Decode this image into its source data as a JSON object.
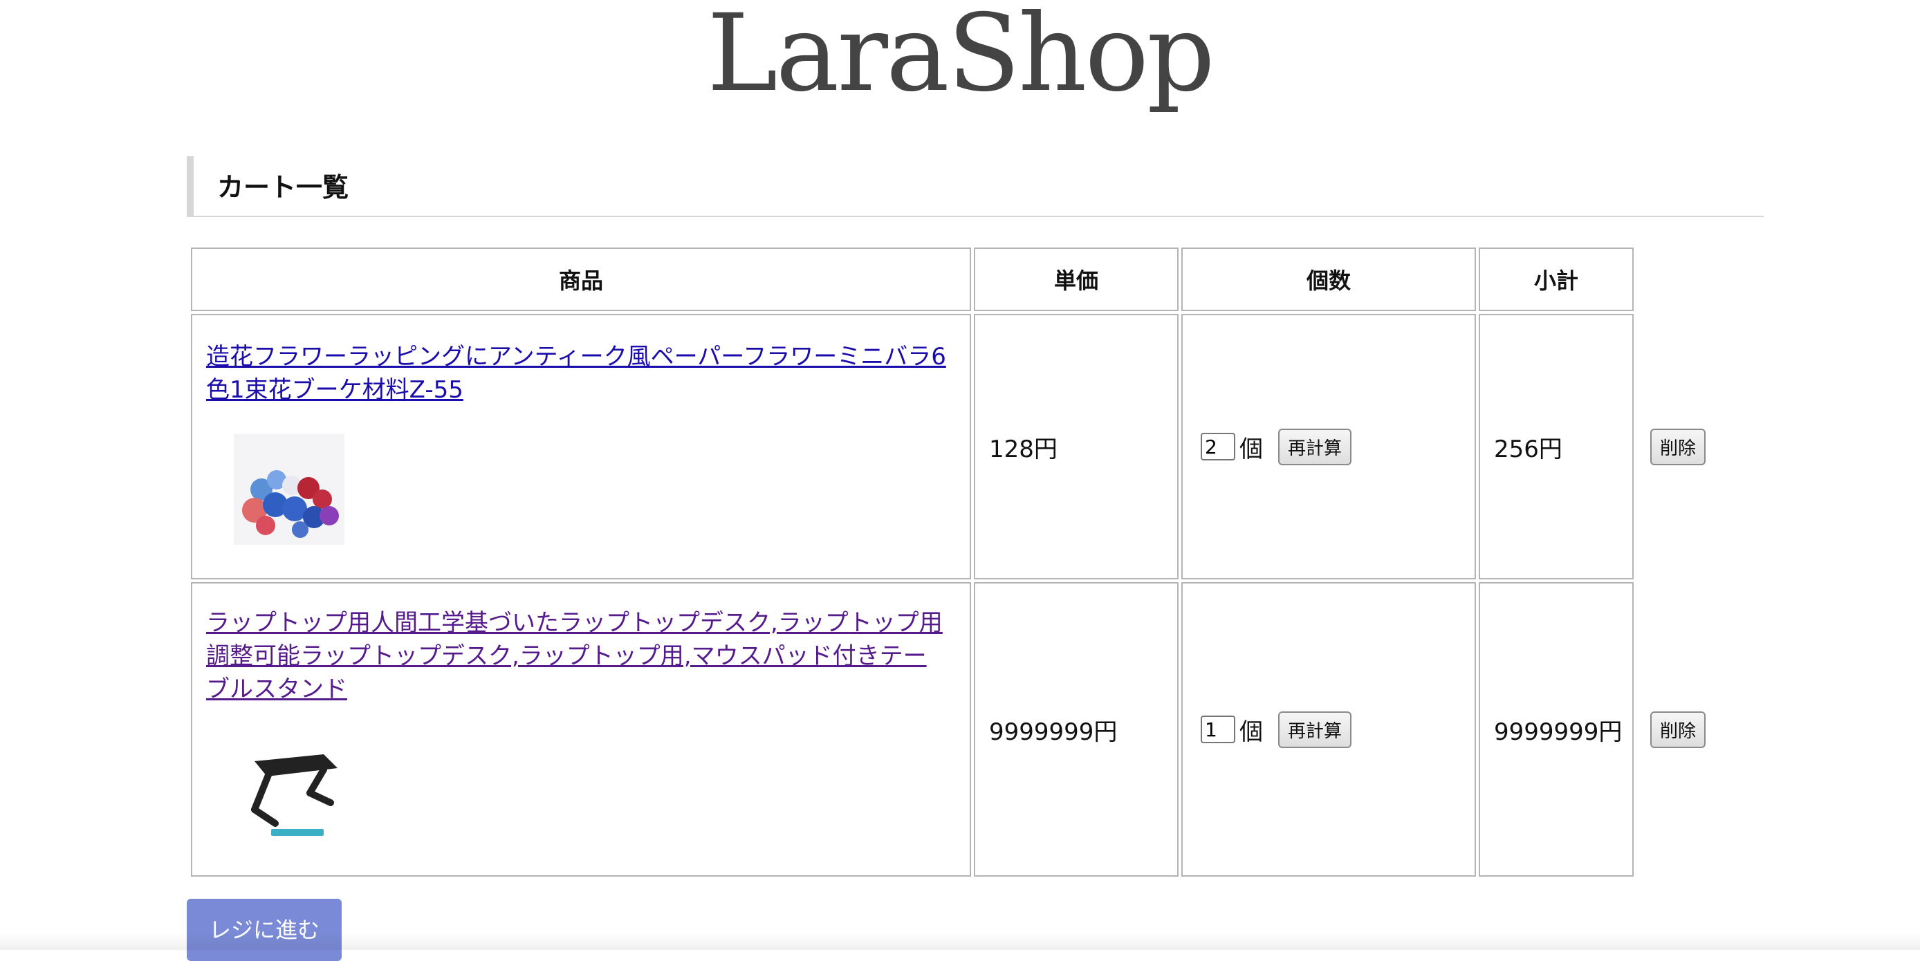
{
  "site": {
    "logo": "LaraShop"
  },
  "page": {
    "title": "カート一覧"
  },
  "cart": {
    "headers": {
      "product": "商品",
      "unit_price": "単価",
      "quantity": "個数",
      "subtotal": "小計"
    },
    "rows": [
      {
        "name": "造花フラワーラッピングにアンティーク風ペーパーフラワーミニバラ6色1束花ブーケ材料Z-55",
        "unit_price": "128円",
        "quantity": "2",
        "unit": "個",
        "recalc_label": "再計算",
        "subtotal": "256円",
        "delete_label": "削除"
      },
      {
        "name": "ラップトップ用人間工学基づいたラップトップデスク,ラップトップ用調整可能ラップトップデスク,ラップトップ用,マウスパッド付きテーブルスタンド",
        "unit_price": "9999999円",
        "quantity": "1",
        "unit": "個",
        "recalc_label": "再計算",
        "subtotal": "9999999円",
        "delete_label": "削除"
      }
    ]
  },
  "checkout": {
    "label": "レジに進む"
  },
  "colors": {
    "link": "#1a0dab",
    "visited_link": "#551a8b",
    "checkout_button": "#7a8ad6",
    "logo": "#444444"
  },
  "icons": {
    "row1_image": "flower-bouquet-image",
    "row2_image": "laptop-stand-image"
  }
}
